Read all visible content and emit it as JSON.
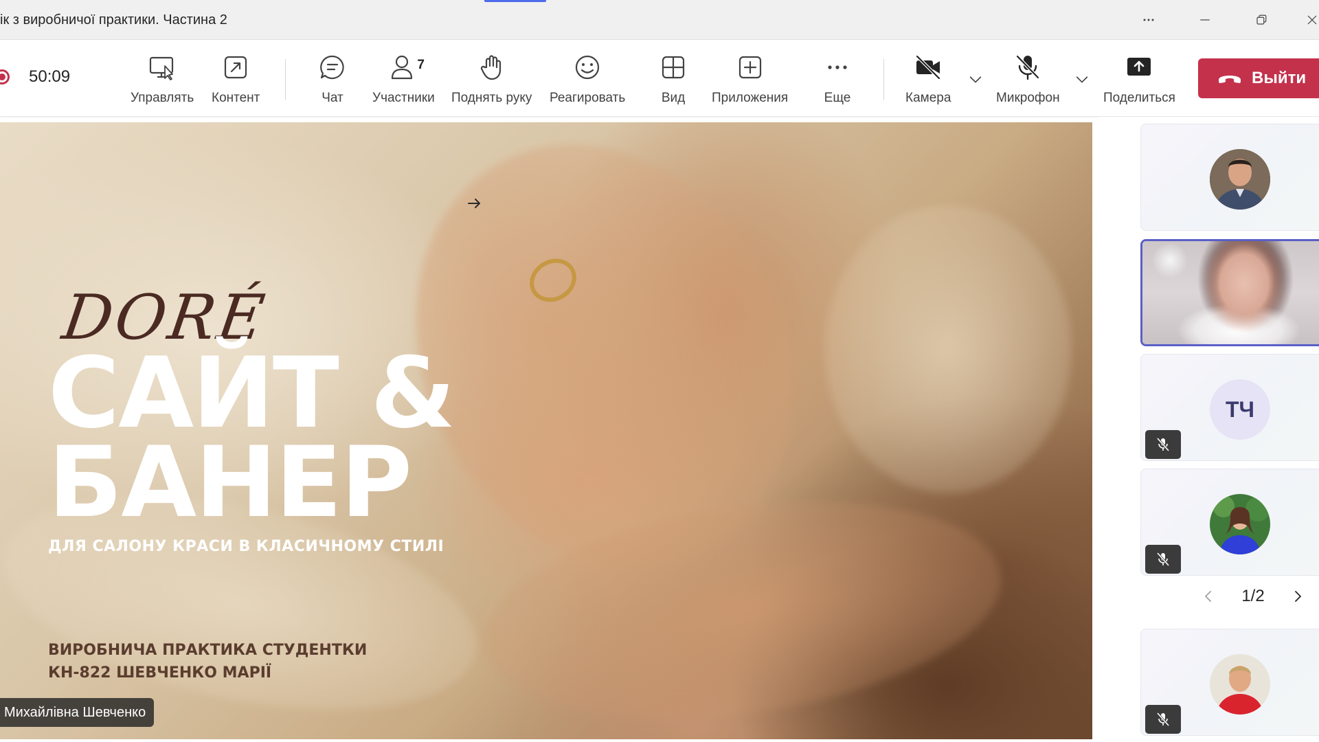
{
  "window": {
    "title": "ік з виробничої практики. Частина 2"
  },
  "toolbar": {
    "timer": "50:09",
    "manage_label": "Управлять",
    "content_label": "Контент",
    "chat_label": "Чат",
    "participants_label": "Участники",
    "participants_count": "7",
    "raise_hand_label": "Поднять руку",
    "react_label": "Реагировать",
    "view_label": "Вид",
    "apps_label": "Приложения",
    "more_label": "Еще",
    "camera_label": "Камера",
    "mic_label": "Микрофон",
    "share_label": "Поделиться",
    "leave_label": "Выйти",
    "colors": {
      "leave": "#c4314b",
      "active_tile": "#5b5fc7"
    }
  },
  "slide": {
    "logo": "DORÉ",
    "title_line1": "САЙТ &",
    "title_line2": "БАНЕР",
    "subtitle": "ДЛЯ САЛОНУ КРАСИ В КЛАСИЧНОМУ СТИЛІ",
    "caption_line1": "ВИРОБНИЧА ПРАКТИКА СТУДЕНТКИ",
    "caption_line2": "КН-822 ШЕВЧЕНКО МАРІЇ",
    "presenter_name": "Михайлівна Шевченко"
  },
  "participants": {
    "tiles": [
      {
        "kind": "avatar",
        "muted": false
      },
      {
        "kind": "video",
        "muted": false,
        "active": true
      },
      {
        "kind": "initials",
        "initials": "ТЧ",
        "muted": true
      },
      {
        "kind": "avatar",
        "muted": true
      },
      {
        "kind": "avatar",
        "muted": true
      }
    ],
    "pager": "1/2"
  }
}
